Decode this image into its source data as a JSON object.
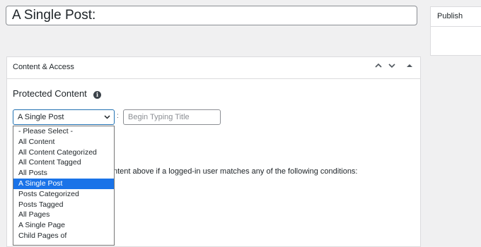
{
  "post": {
    "title_value": "A Single Post:"
  },
  "publish": {
    "title": "Publish"
  },
  "metabox": {
    "title": "Content & Access",
    "controls": {
      "up": "⌃",
      "down": "⌄",
      "toggle": "▲"
    },
    "section_title": "Protected Content",
    "info_icon": "info-icon",
    "content_type_selected": "A Single Post",
    "separator": ":",
    "title_search_placeholder": "Begin Typing Title",
    "help_text": "ntent above if a logged-in user matches any of the following conditions:",
    "stub_a": "",
    "stub_b": ""
  },
  "dropdown": {
    "options": [
      {
        "label": "- Please Select -",
        "selected": false
      },
      {
        "label": "All Content",
        "selected": false
      },
      {
        "label": "All Content Categorized",
        "selected": false
      },
      {
        "label": "All Content Tagged",
        "selected": false
      },
      {
        "label": "All Posts",
        "selected": false
      },
      {
        "label": "A Single Post",
        "selected": true
      },
      {
        "label": "Posts Categorized",
        "selected": false
      },
      {
        "label": "Posts Tagged",
        "selected": false
      },
      {
        "label": "All Pages",
        "selected": false
      },
      {
        "label": "A Single Page",
        "selected": false
      },
      {
        "label": "Child Pages of",
        "selected": false
      }
    ]
  },
  "colors": {
    "accent": "#2271b1",
    "selected_bg": "#1a73e8",
    "background": "#f0f0f1"
  }
}
